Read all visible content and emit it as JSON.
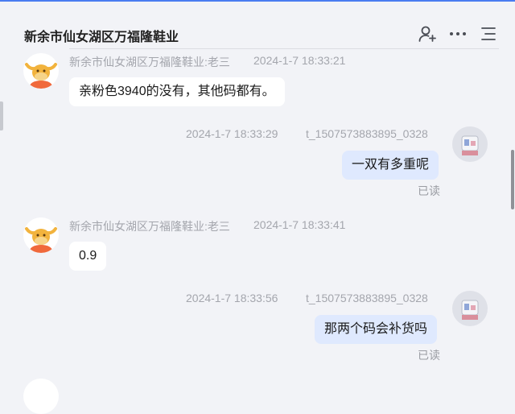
{
  "header": {
    "title": "新余市仙女湖区万福隆鞋业",
    "icons": [
      "add-member-icon",
      "more-dots-icon",
      "menu-list-icon"
    ]
  },
  "messages": [
    {
      "side": "left",
      "sender": "新余市仙女湖区万福隆鞋业:老三",
      "time": "2024-1-7 18:33:21",
      "text": "亲粉色3940的没有，其他码都有。"
    },
    {
      "side": "right",
      "sender": "t_1507573883895_0328",
      "time": "2024-1-7 18:33:29",
      "text": "一双有多重呢",
      "status": "已读"
    },
    {
      "side": "left",
      "sender": "新余市仙女湖区万福隆鞋业:老三",
      "time": "2024-1-7 18:33:41",
      "text": "0.9"
    },
    {
      "side": "right",
      "sender": "t_1507573883895_0328",
      "time": "2024-1-7 18:33:56",
      "text": "那两个码会补货吗",
      "status": "已读"
    }
  ],
  "colors": {
    "accent": "#4a7cf0",
    "right_bubble": "#dfe9fe",
    "left_bubble": "#ffffff",
    "background": "#f2f3f7"
  }
}
